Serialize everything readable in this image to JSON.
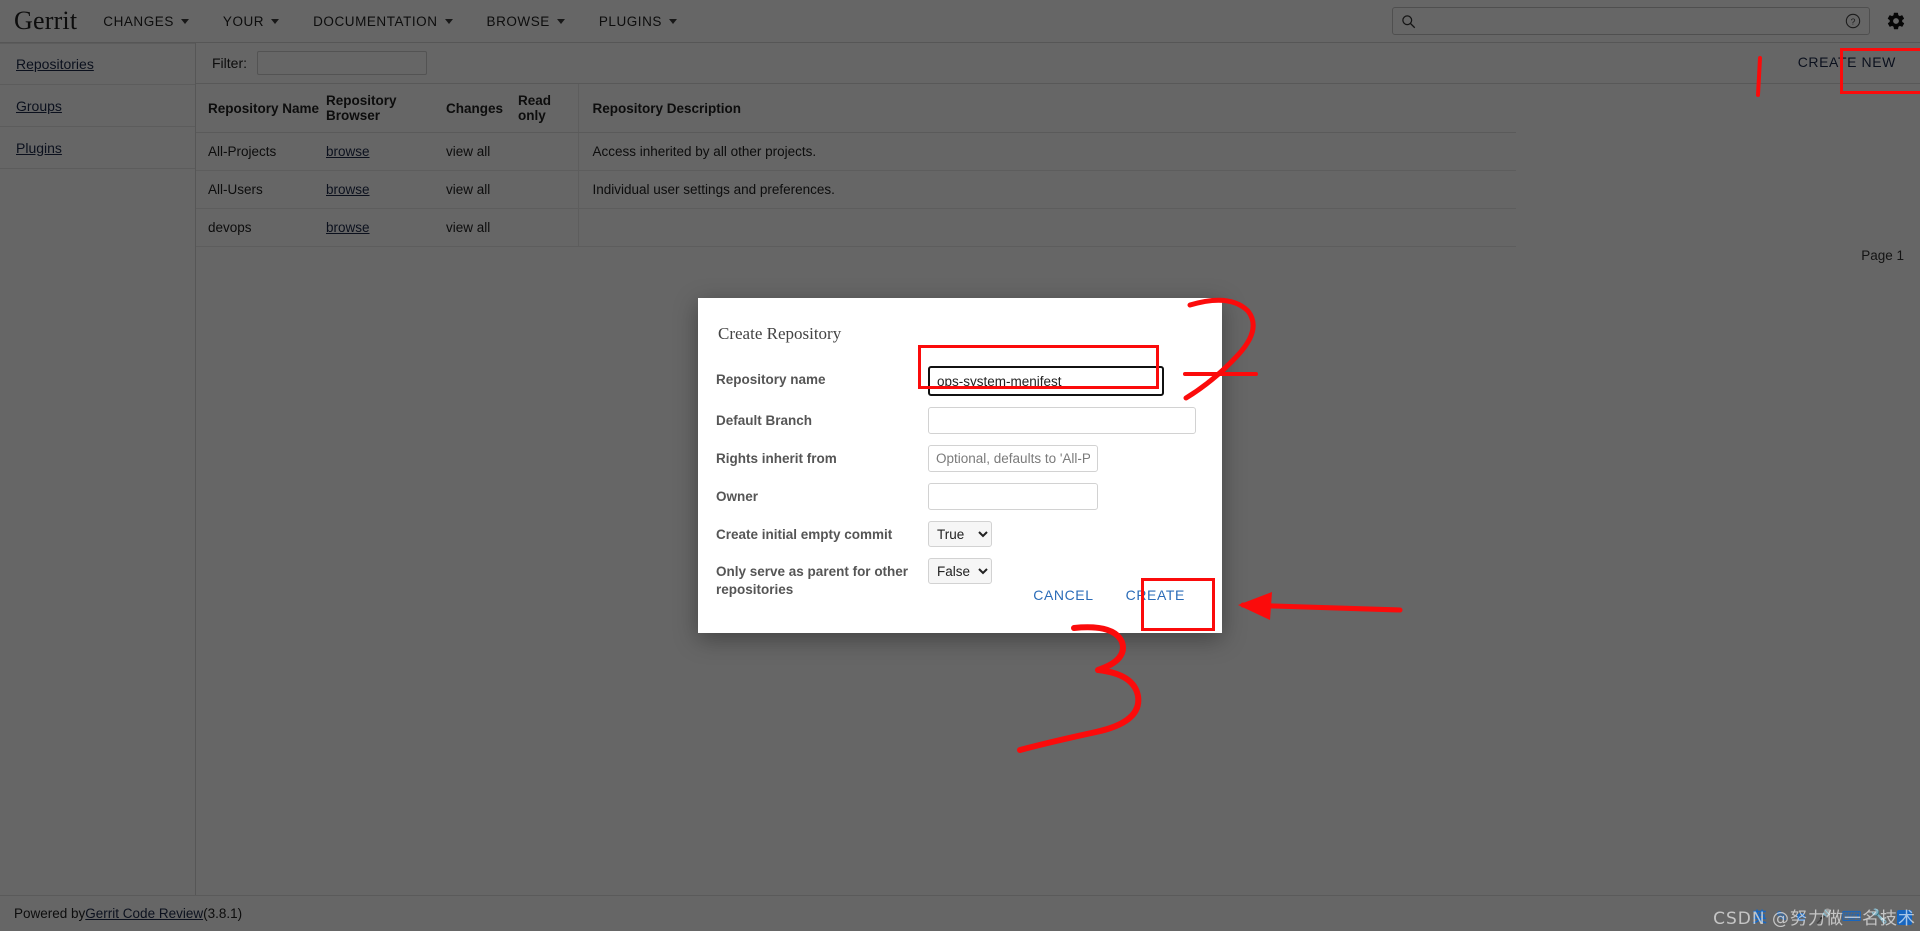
{
  "header": {
    "brand": "Gerrit",
    "nav": [
      {
        "label": "CHANGES",
        "icon": "chevron-down-icon"
      },
      {
        "label": "YOUR",
        "icon": "chevron-down-icon"
      },
      {
        "label": "DOCUMENTATION",
        "icon": "chevron-down-icon"
      },
      {
        "label": "BROWSE",
        "icon": "chevron-down-icon"
      },
      {
        "label": "PLUGINS",
        "icon": "chevron-down-icon"
      }
    ],
    "search": {
      "value": "",
      "placeholder": "",
      "icon": "search-icon"
    },
    "help_icon": "help-circle-icon",
    "settings_icon": "gear-icon"
  },
  "sidebar": {
    "items": [
      {
        "label": "Repositories"
      },
      {
        "label": "Groups"
      },
      {
        "label": "Plugins"
      }
    ]
  },
  "toolbar": {
    "filter_label": "Filter:",
    "filter_value": "",
    "filter_placeholder": "",
    "create_new_label": "CREATE NEW"
  },
  "table": {
    "columns": [
      "Repository Name",
      "Repository Browser",
      "Changes",
      "Read only",
      "Repository Description"
    ],
    "rows": [
      {
        "name": "All-Projects",
        "browser": "browse",
        "changes": "view all",
        "read_only": "",
        "description": "Access inherited by all other projects."
      },
      {
        "name": "All-Users",
        "browser": "browse",
        "changes": "view all",
        "read_only": "",
        "description": "Individual user settings and preferences."
      },
      {
        "name": "devops",
        "browser": "browse",
        "changes": "view all",
        "read_only": "",
        "description": ""
      }
    ],
    "page_label": "Page 1"
  },
  "footer": {
    "prefix": "Powered by ",
    "link": "Gerrit Code Review",
    "version": " (3.8.1)"
  },
  "modal": {
    "title": "Create Repository",
    "fields": {
      "repository_name": {
        "label": "Repository name",
        "value": "ops-system-menifest",
        "placeholder": ""
      },
      "default_branch": {
        "label": "Default Branch",
        "value": "",
        "placeholder": ""
      },
      "rights_inherit_from": {
        "label": "Rights inherit from",
        "value": "",
        "placeholder": "Optional, defaults to 'All-Projects'"
      },
      "owner": {
        "label": "Owner",
        "value": "",
        "placeholder": ""
      },
      "create_initial_empty_commit": {
        "label": "Create initial empty commit",
        "value": "True",
        "options": [
          "True",
          "False"
        ]
      },
      "only_serve_as_parent": {
        "label": "Only serve as parent for other repositories",
        "value": "False",
        "options": [
          "True",
          "False"
        ]
      }
    },
    "cancel_label": "CANCEL",
    "create_label": "CREATE"
  },
  "annotations": {
    "color": "#fb0b0b",
    "marks": [
      "2",
      "3"
    ]
  },
  "watermark": {
    "text": "CSDN @努力做一名技术"
  },
  "colors": {
    "accent_link": "#1c2a4a",
    "button_blue": "#2b6cb8",
    "annotation_red": "#fb0b0b",
    "overlay": "rgba(0,0,0,0.6)"
  }
}
